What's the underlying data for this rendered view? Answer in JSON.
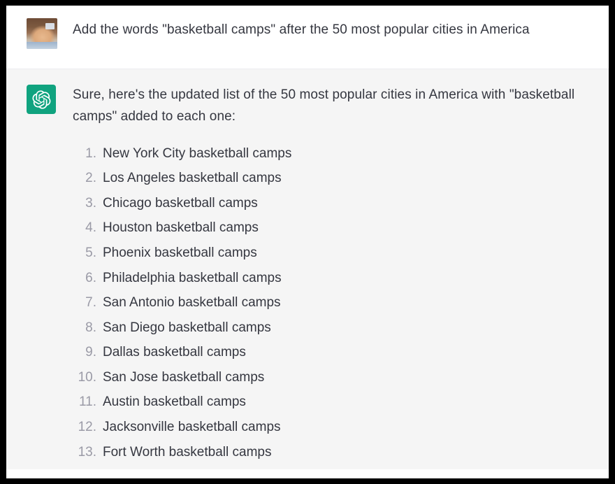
{
  "window": {
    "frame_color": "#000000",
    "user_bg": "#ffffff",
    "assistant_bg": "#f5f5f5",
    "text_color": "#353740",
    "number_color": "#9a9aa6",
    "brand_green": "#10a37f"
  },
  "messages": {
    "user": {
      "avatar_name": "user-photo-avatar",
      "text": "Add the words \"basketball camps\" after the 50 most popular cities in America"
    },
    "assistant": {
      "avatar_name": "chatgpt-logo-icon",
      "intro": "Sure, here's the updated list of the 50 most popular cities in America with \"basketball camps\" added to each one:",
      "list": [
        {
          "num": "1.",
          "text": "New York City basketball camps"
        },
        {
          "num": "2.",
          "text": "Los Angeles basketball camps"
        },
        {
          "num": "3.",
          "text": "Chicago basketball camps"
        },
        {
          "num": "4.",
          "text": "Houston basketball camps"
        },
        {
          "num": "5.",
          "text": "Phoenix basketball camps"
        },
        {
          "num": "6.",
          "text": "Philadelphia basketball camps"
        },
        {
          "num": "7.",
          "text": "San Antonio basketball camps"
        },
        {
          "num": "8.",
          "text": "San Diego basketball camps"
        },
        {
          "num": "9.",
          "text": "Dallas basketball camps"
        },
        {
          "num": "10.",
          "text": "San Jose basketball camps"
        },
        {
          "num": "11.",
          "text": "Austin basketball camps"
        },
        {
          "num": "12.",
          "text": "Jacksonville basketball camps"
        },
        {
          "num": "13.",
          "text": "Fort Worth basketball camps"
        }
      ]
    }
  }
}
